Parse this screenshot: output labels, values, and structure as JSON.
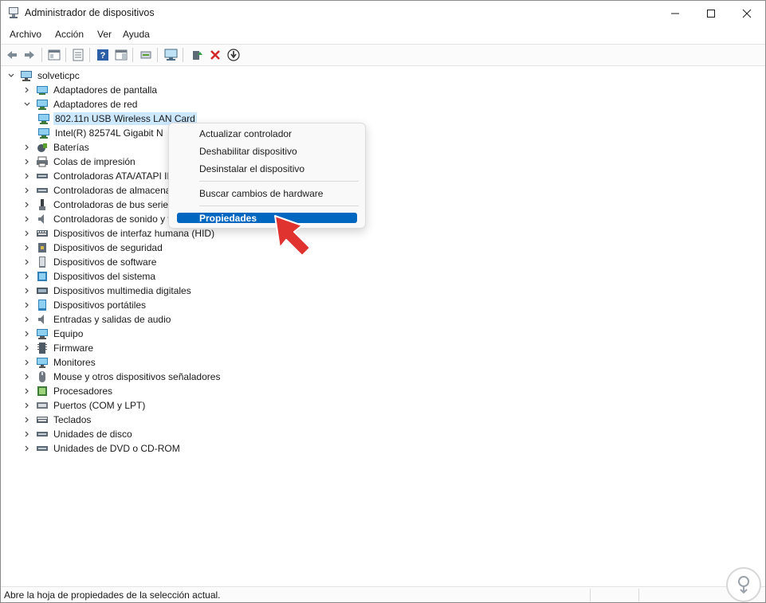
{
  "window": {
    "title": "Administrador de dispositivos",
    "minimize_label": "Minimizar",
    "maximize_label": "Maximizar",
    "close_label": "Cerrar"
  },
  "menu": {
    "items": [
      "Archivo",
      "Acción",
      "Ver",
      "Ayuda"
    ]
  },
  "toolbar": {
    "buttons": [
      {
        "icon": "back-arrow-icon"
      },
      {
        "icon": "forward-arrow-icon"
      },
      {
        "icon": "show-hide-console-tree-icon"
      },
      {
        "icon": "properties-sheet-icon"
      },
      {
        "icon": "help-icon"
      },
      {
        "icon": "action-pane-icon"
      },
      {
        "icon": "update-driver-icon"
      },
      {
        "icon": "scan-hardware-icon"
      },
      {
        "icon": "enable-device-icon"
      },
      {
        "icon": "uninstall-device-icon"
      },
      {
        "icon": "disable-device-icon"
      }
    ]
  },
  "tree": {
    "root": "solveticpc",
    "items": [
      {
        "label": "Adaptadores de pantalla",
        "icon": "display-adapter-icon",
        "expanded": false
      },
      {
        "label": "Adaptadores de red",
        "icon": "network-adapter-icon",
        "expanded": true
      },
      {
        "label": "802.11n USB Wireless LAN Card",
        "icon": "network-card-icon",
        "child": true,
        "selected": true
      },
      {
        "label": "Intel(R) 82574L Gigabit N",
        "icon": "network-card-icon",
        "child": true
      },
      {
        "label": "Baterías",
        "icon": "battery-icon"
      },
      {
        "label": "Colas de impresión",
        "icon": "printer-icon"
      },
      {
        "label": "Controladoras ATA/ATAPI ID",
        "icon": "ide-controller-icon"
      },
      {
        "label": "Controladoras de almacena",
        "icon": "storage-controller-icon"
      },
      {
        "label": "Controladoras de bus serie u",
        "icon": "usb-controller-icon"
      },
      {
        "label": "Controladoras de sonido y v",
        "icon": "sound-icon"
      },
      {
        "label": "Dispositivos de interfaz humana (HID)",
        "icon": "hid-icon"
      },
      {
        "label": "Dispositivos de seguridad",
        "icon": "security-device-icon"
      },
      {
        "label": "Dispositivos de software",
        "icon": "software-device-icon"
      },
      {
        "label": "Dispositivos del sistema",
        "icon": "system-device-icon"
      },
      {
        "label": "Dispositivos multimedia digitales",
        "icon": "multimedia-icon"
      },
      {
        "label": "Dispositivos portátiles",
        "icon": "portable-device-icon"
      },
      {
        "label": "Entradas y salidas de audio",
        "icon": "audio-io-icon"
      },
      {
        "label": "Equipo",
        "icon": "computer-icon"
      },
      {
        "label": "Firmware",
        "icon": "firmware-icon"
      },
      {
        "label": "Monitores",
        "icon": "monitor-icon"
      },
      {
        "label": "Mouse y otros dispositivos señaladores",
        "icon": "mouse-icon"
      },
      {
        "label": "Procesadores",
        "icon": "processor-icon"
      },
      {
        "label": "Puertos (COM y LPT)",
        "icon": "port-icon"
      },
      {
        "label": "Teclados",
        "icon": "keyboard-icon"
      },
      {
        "label": "Unidades de disco",
        "icon": "disk-drive-icon"
      },
      {
        "label": "Unidades de DVD o CD-ROM",
        "icon": "dvd-drive-icon"
      }
    ]
  },
  "context_menu": {
    "items": [
      "Actualizar controlador",
      "Deshabilitar dispositivo",
      "Desinstalar el dispositivo",
      "Buscar cambios de hardware",
      "Propiedades"
    ]
  },
  "status": {
    "text": "Abre la hoja de propiedades de la selección actual."
  },
  "colors": {
    "accent": "#0067c0",
    "selection": "#cce8ff",
    "pointer_arrow": "#e0332f"
  }
}
